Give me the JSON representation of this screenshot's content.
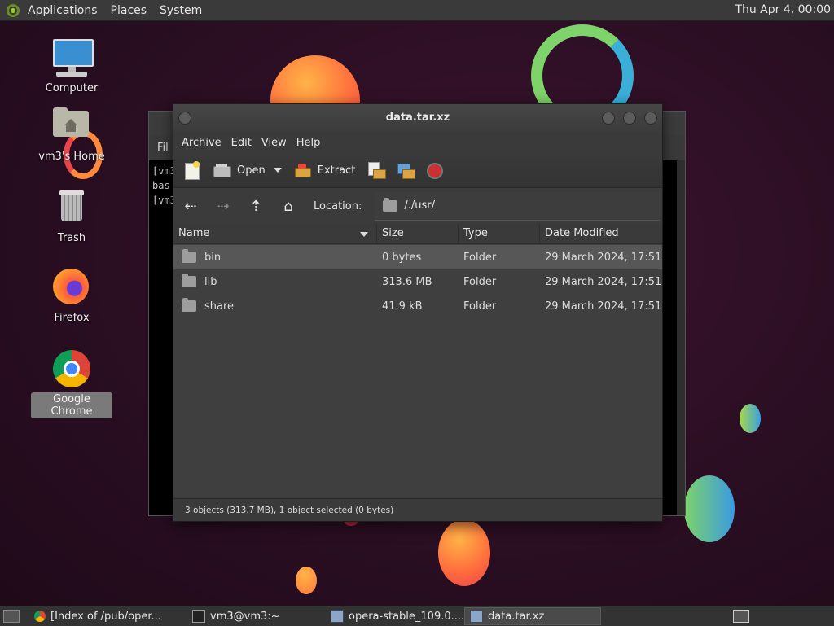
{
  "top_panel": {
    "menus": [
      "Applications",
      "Places",
      "System"
    ],
    "clock": "Thu Apr  4, 00:00"
  },
  "desktop": {
    "icons": [
      {
        "label": "Computer",
        "icon": "computer-icon"
      },
      {
        "label": "vm3's Home",
        "icon": "home-folder-icon"
      },
      {
        "label": "Trash",
        "icon": "trash-icon"
      },
      {
        "label": "Firefox",
        "icon": "firefox-icon"
      },
      {
        "label": "Google Chrome",
        "icon": "chrome-icon",
        "selected": true
      }
    ]
  },
  "terminal": {
    "menu_partial": "Fil",
    "lines": [
      "[vm3",
      "bas",
      "[vm3"
    ]
  },
  "window": {
    "title": "data.tar.xz",
    "menu": [
      "Archive",
      "Edit",
      "View",
      "Help"
    ],
    "toolbar": {
      "open_label": "Open",
      "extract_label": "Extract"
    },
    "location_label": "Location:",
    "location_value": "/./usr/",
    "columns": [
      "Name",
      "Size",
      "Type",
      "Date Modified"
    ],
    "rows": [
      {
        "name": "bin",
        "size": "0 bytes",
        "type": "Folder",
        "date": "29 March 2024, 17:51",
        "selected": true
      },
      {
        "name": "lib",
        "size": "313.6 MB",
        "type": "Folder",
        "date": "29 March 2024, 17:51"
      },
      {
        "name": "share",
        "size": "41.9 kB",
        "type": "Folder",
        "date": "29 March 2024, 17:51"
      }
    ],
    "status": "3 objects (313.7 MB), 1 object selected (0 bytes)"
  },
  "taskbar": {
    "tasks": [
      {
        "label": "[Index of /pub/oper...",
        "icon": "chrome-icon"
      },
      {
        "label": "vm3@vm3:~",
        "icon": "terminal-icon"
      },
      {
        "label": "opera-stable_109.0....",
        "icon": "archive-icon"
      },
      {
        "label": "data.tar.xz",
        "icon": "archive-icon",
        "active": true
      }
    ]
  },
  "colors": {
    "accent_selected": "#575757",
    "panel": "#3a3a3a",
    "wallpaper": "#2a0f22"
  }
}
